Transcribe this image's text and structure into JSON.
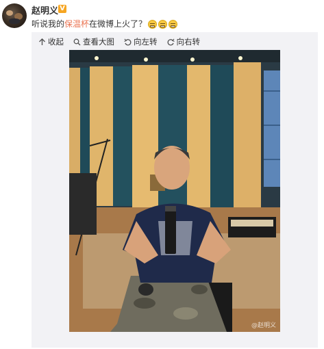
{
  "post": {
    "username": "赵明义",
    "badge": "V",
    "text_before": "听说我的",
    "text_link": "保温杯",
    "text_after": "在微博上火了？",
    "emoji_count": 3,
    "emoji_icon": "grimace-face-icon"
  },
  "toolbar": {
    "collapse_label": "收起",
    "view_large_label": "查看大图",
    "rotate_left_label": "向左转",
    "rotate_right_label": "向右转"
  },
  "photo": {
    "watermark": "@赵明义"
  },
  "colors": {
    "link": "#eb7350",
    "panel_bg": "#f2f2f5",
    "badge": "#f6a623"
  }
}
